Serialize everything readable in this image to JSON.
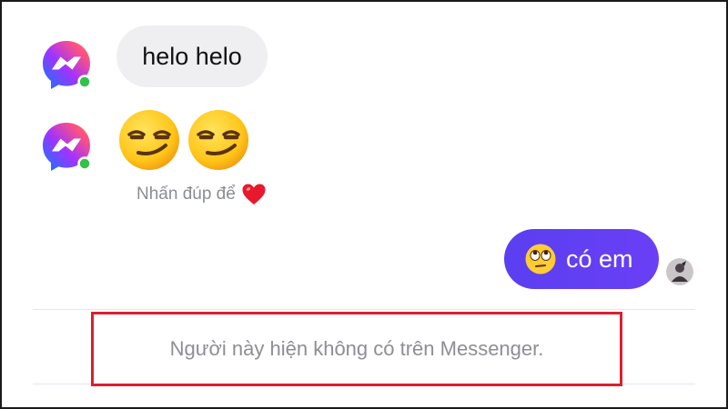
{
  "conversation": {
    "messages": [
      {
        "from": "contact",
        "text": "helo helo"
      },
      {
        "from": "contact",
        "emoji": "😏😏"
      },
      {
        "from": "me",
        "emoji": "🙄",
        "text": "có em"
      }
    ],
    "double_tap_hint": "Nhấn đúp để",
    "double_tap_hint_emoji": "❤️"
  },
  "status_notice": "Người này hiện không có trên Messenger.",
  "colors": {
    "incoming_bubble": "#efeff1",
    "outgoing_bubble": "#5b3cf5",
    "online_dot": "#31c24a",
    "highlight_border": "#d9202f",
    "hint_text": "#8a8d91"
  },
  "icons": {
    "contact_avatar": "messenger-logo-icon",
    "seen_indicator": "user-avatar-icon"
  }
}
